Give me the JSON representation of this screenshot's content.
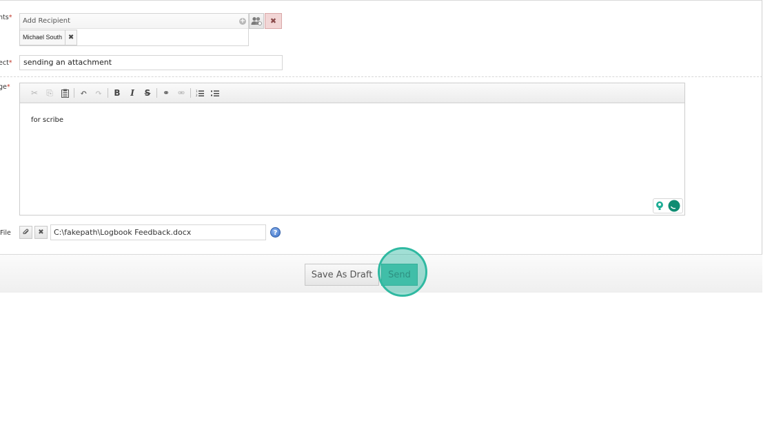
{
  "form": {
    "recipients_label": "nts",
    "subject_label": "ect",
    "message_label": "ge",
    "file_label": "File",
    "required_mark": "*"
  },
  "recipients": {
    "placeholder": "Add Recipient",
    "chips": [
      {
        "name": "Michael South"
      }
    ],
    "remove_glyph": "✖",
    "clear_glyph": "✖"
  },
  "subject": {
    "value": "sending an attachment"
  },
  "editor": {
    "toolbar": [
      {
        "name": "cut-icon",
        "glyph": "✂",
        "enabled": false
      },
      {
        "name": "copy-icon",
        "glyph": "⎘",
        "enabled": false
      },
      {
        "name": "paste-icon",
        "glyph": "📋",
        "enabled": true
      },
      {
        "name": "undo-icon",
        "glyph": "↶",
        "enabled": true
      },
      {
        "name": "redo-icon",
        "glyph": "↷",
        "enabled": false
      },
      {
        "name": "bold-icon",
        "glyph": "B",
        "enabled": true
      },
      {
        "name": "italic-icon",
        "glyph": "I",
        "enabled": true
      },
      {
        "name": "strike-icon",
        "glyph": "S",
        "enabled": true
      },
      {
        "name": "link-icon",
        "glyph": "⚭",
        "enabled": true
      },
      {
        "name": "unlink-icon",
        "glyph": "⚮",
        "enabled": false
      },
      {
        "name": "numbered-list-icon",
        "glyph": "☰",
        "enabled": true
      },
      {
        "name": "bulleted-list-icon",
        "glyph": "☷",
        "enabled": true
      }
    ],
    "body": "for scribe"
  },
  "file": {
    "path": "C:\\fakepath\\Logbook Feedback.docx",
    "attach_icon": "paperclip-icon",
    "remove_icon": "close-icon",
    "help_glyph": "?"
  },
  "footer": {
    "save_draft_label": "Save As Draft",
    "send_label": "Send"
  },
  "colors": {
    "accent": "#2fb9a1",
    "send_bg": "#4fc3ad",
    "clear_bg": "#f2d6d6",
    "required": "#c0392b"
  }
}
